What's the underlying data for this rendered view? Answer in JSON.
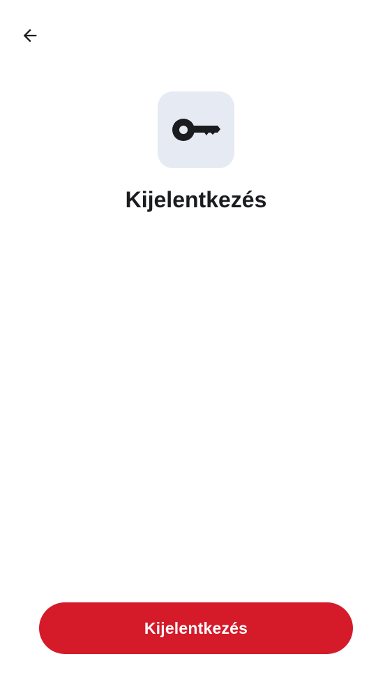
{
  "header": {
    "back_icon": "arrow-back-icon"
  },
  "hero": {
    "icon": "key-icon",
    "icon_tile_color": "#e6eaf2",
    "title": "Kijelentkezés"
  },
  "actions": {
    "primary_label": "Kijelentkezés",
    "primary_color": "#d51a2a"
  }
}
